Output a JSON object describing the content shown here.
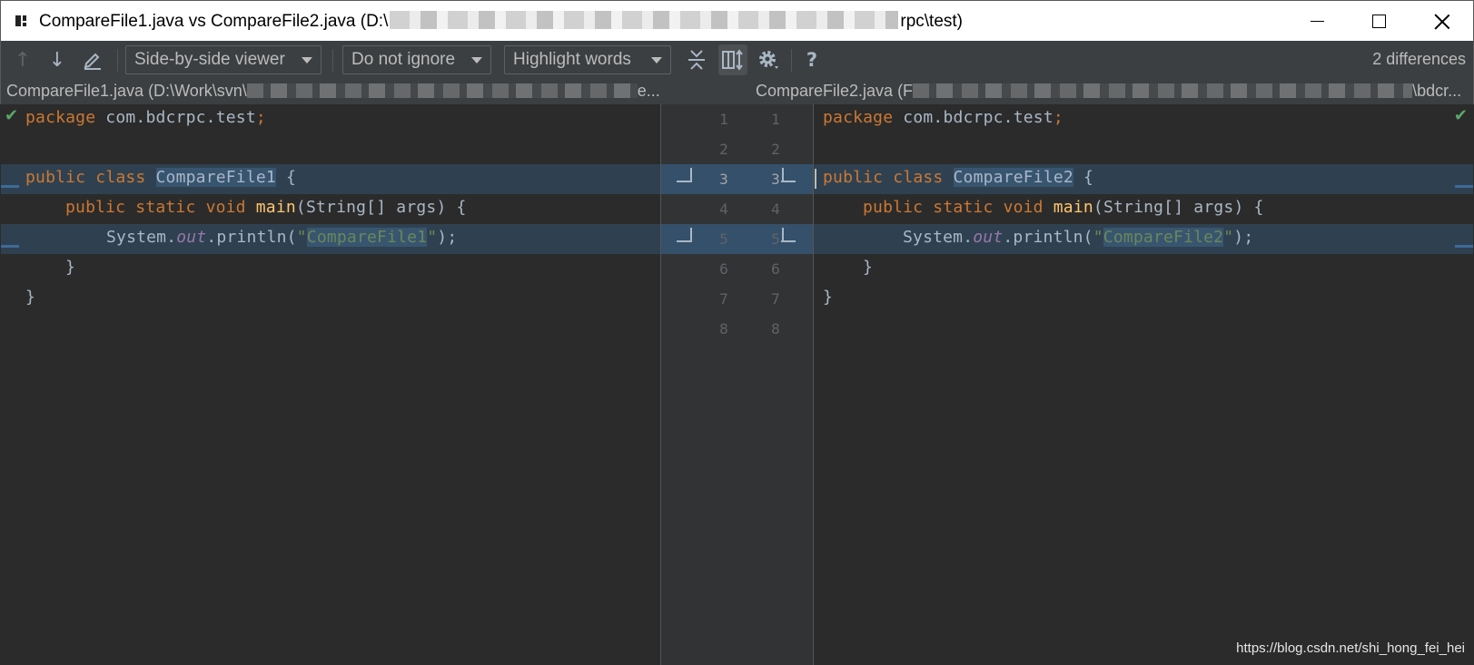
{
  "window": {
    "title_start": "CompareFile1.java vs CompareFile2.java (D:\\",
    "title_end": "rpc\\test)"
  },
  "toolbar": {
    "viewer_combo": "Side-by-side viewer",
    "ignore_combo": "Do not ignore",
    "highlight_combo": "Highlight words",
    "help_label": "?",
    "differences_label": "2 differences"
  },
  "left_file": {
    "header": "CompareFile1.java (D:\\Work\\svn\\",
    "header_tail": "e...",
    "lines": [
      {
        "num": "1",
        "text": "package com.bdcrpc.test;"
      },
      {
        "num": "2",
        "text": ""
      },
      {
        "num": "3",
        "text": "public class CompareFile1 {"
      },
      {
        "num": "4",
        "text": "    public static void main(String[] args) {"
      },
      {
        "num": "5",
        "text": "        System.out.println(\"CompareFile1\");"
      },
      {
        "num": "6",
        "text": "    }"
      },
      {
        "num": "7",
        "text": "}"
      },
      {
        "num": "8",
        "text": ""
      }
    ]
  },
  "right_file": {
    "header": "CompareFile2.java (F",
    "header_tail": "\\bdcr...",
    "lines": [
      {
        "num": "1",
        "text": "package com.bdcrpc.test;"
      },
      {
        "num": "2",
        "text": ""
      },
      {
        "num": "3",
        "text": "public class CompareFile2 {"
      },
      {
        "num": "4",
        "text": "    public static void main(String[] args) {"
      },
      {
        "num": "5",
        "text": "        System.out.println(\"CompareFile2\");"
      },
      {
        "num": "6",
        "text": "    }"
      },
      {
        "num": "7",
        "text": "}"
      },
      {
        "num": "8",
        "text": ""
      }
    ]
  },
  "code_tokens": {
    "package_kw": "package",
    "package_name": " com.bdcrpc.test",
    "semicolon": ";",
    "public_kw": "public",
    "class_kw": "class",
    "left_class": "CompareFile1",
    "right_class": "CompareFile2",
    "open_brace": " {",
    "static_kw": "static",
    "void_kw": "void",
    "main_fn": "main",
    "main_args": "(String[] args) {",
    "system": "System.",
    "out_field": "out",
    "println": ".println(",
    "quote": "\"",
    "left_str": "CompareFile1",
    "right_str": "CompareFile2",
    "close_call": ");",
    "close_brace": "}"
  },
  "diff_count": 2,
  "watermark": "https://blog.csdn.net/shi_hong_fei_hei",
  "colors": {
    "background": "#2b2b2b",
    "changed_line": "#2f4150",
    "word_highlight": "#385570",
    "keyword": "#cc7832",
    "function": "#ffc66d",
    "string": "#6a8759",
    "field_italic": "#9876aa",
    "ok_check": "#59a869"
  }
}
